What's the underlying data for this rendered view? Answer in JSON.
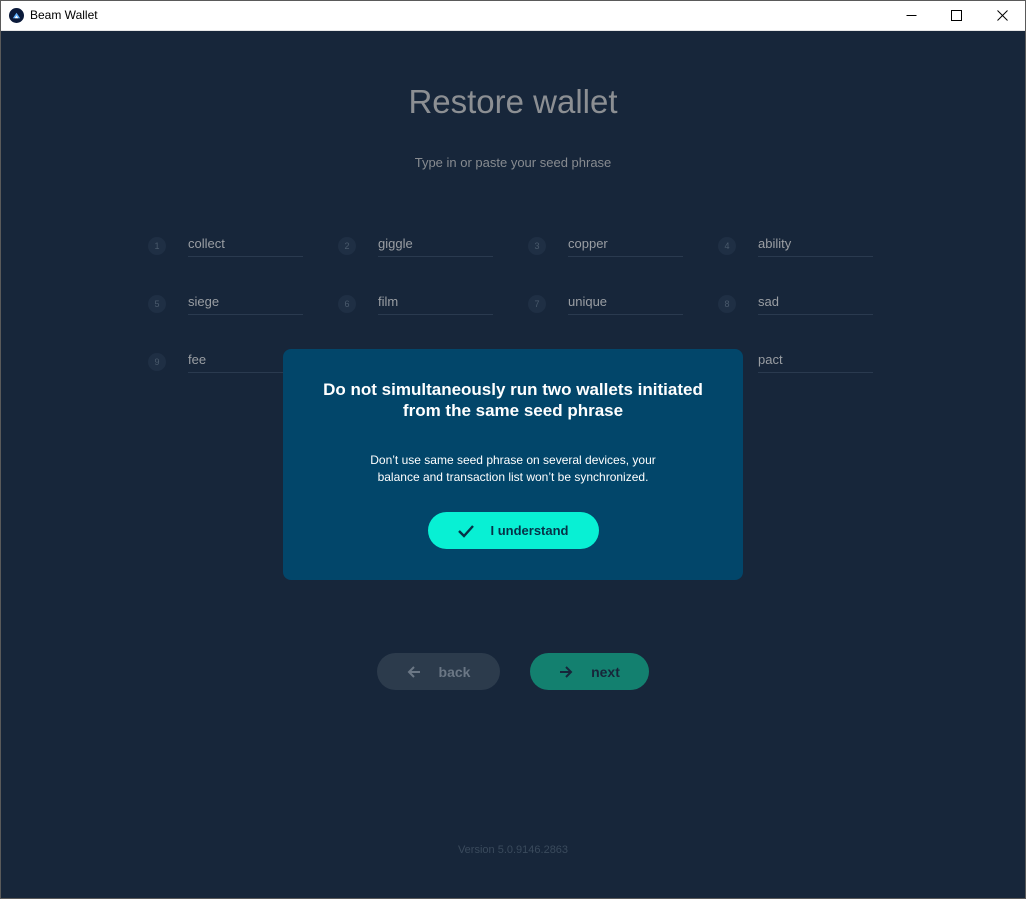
{
  "window": {
    "title": "Beam Wallet"
  },
  "page": {
    "title": "Restore wallet",
    "subtitle": "Type in or paste your seed phrase"
  },
  "seed_words": [
    {
      "num": "1",
      "word": "collect"
    },
    {
      "num": "2",
      "word": "giggle"
    },
    {
      "num": "3",
      "word": "copper"
    },
    {
      "num": "4",
      "word": "ability"
    },
    {
      "num": "5",
      "word": "siege"
    },
    {
      "num": "6",
      "word": "film"
    },
    {
      "num": "7",
      "word": "unique"
    },
    {
      "num": "8",
      "word": "sad"
    },
    {
      "num": "9",
      "word": "fee"
    },
    {
      "num": "",
      "word": "pact"
    }
  ],
  "nav": {
    "back_label": "back",
    "next_label": "next"
  },
  "version": "Version 5.0.9146.2863",
  "dialog": {
    "title_line1": "Do not simultaneously run two wallets initiated",
    "title_line2": "from the same seed phrase",
    "text_line1": "Don’t use same seed phrase on several devices, your",
    "text_line2": "balance and transaction list won’t be synchronized.",
    "confirm_label": "I understand"
  },
  "colors": {
    "background": "#17263a",
    "dialog": "#02466a",
    "accent": "#08f0d4",
    "next_button": "#13806f"
  },
  "icons": {
    "app": "beam-logo-icon",
    "back": "arrow-left-icon",
    "next": "arrow-right-icon",
    "confirm": "checkmark-icon"
  }
}
